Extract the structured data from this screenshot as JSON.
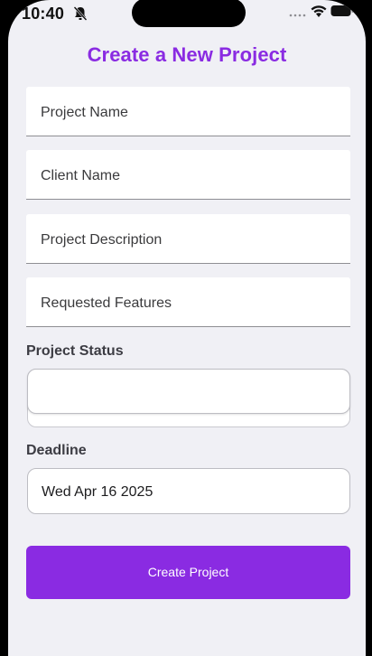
{
  "status_bar": {
    "time": "10:40",
    "icons": [
      "bell-slash-icon",
      "signal-icon",
      "wifi-icon",
      "battery-icon"
    ]
  },
  "page": {
    "title": "Create a New Project",
    "accent_color": "#8a2be2"
  },
  "form": {
    "project_name_placeholder": "Project Name",
    "client_name_placeholder": "Client Name",
    "project_description_placeholder": "Project Description",
    "requested_features_placeholder": "Requested Features",
    "project_status_label": "Project Status",
    "project_status_value": "",
    "deadline_label": "Deadline",
    "deadline_value": "Wed Apr 16 2025",
    "submit_label": "Create Project"
  }
}
